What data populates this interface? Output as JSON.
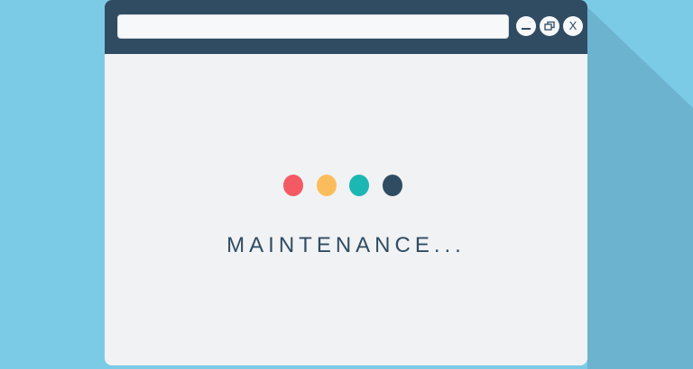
{
  "colors": {
    "background": "#7ccbe6",
    "background_shadow": "#6cb3cf",
    "window_body": "#f1f2f4",
    "title_bar": "#2f4c62",
    "dot_1": "#f45a64",
    "dot_2": "#fbbd5c",
    "dot_3": "#1cb7b2",
    "dot_4": "#2f4c62"
  },
  "browser": {
    "address_bar": {
      "value": "",
      "placeholder": ""
    },
    "buttons": {
      "minimize_icon": "minimize-icon",
      "restore_icon": "restore-icon",
      "close_label": "X"
    }
  },
  "content": {
    "status_text": "MAINTENANCE...",
    "loading_dots": [
      "red",
      "yellow",
      "teal",
      "navy"
    ]
  }
}
